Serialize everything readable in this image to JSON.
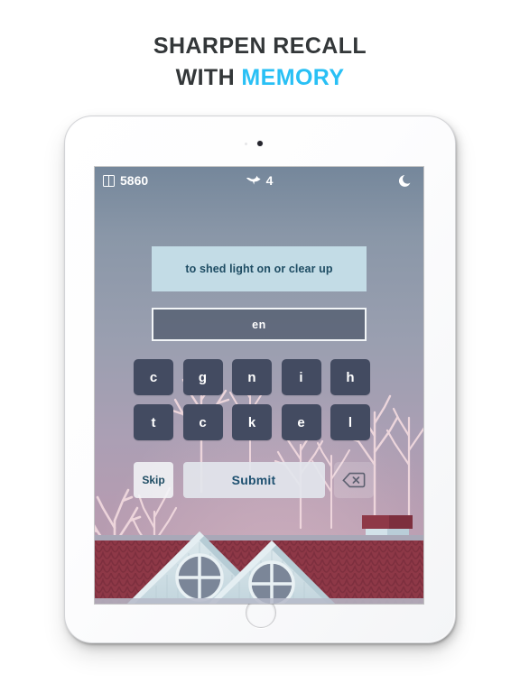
{
  "headline": {
    "line1": "SHARPEN RECALL",
    "line2_prefix": "WITH ",
    "line2_accent": "MEMORY",
    "accent_color": "#29c0f5",
    "text_color": "#333739"
  },
  "device": {
    "type": "tablet",
    "frame_color": "#fbfbfc",
    "camera": "camera-dot",
    "home_button": "home-button"
  },
  "status_bar": {
    "score_icon": "cards-icon",
    "score": "5860",
    "lives_icon": "bird-icon",
    "lives": "4",
    "mode_icon": "moon-icon"
  },
  "quiz": {
    "prompt": "to shed light on or clear up",
    "prompt_bg": "#c3dce6",
    "prompt_text_color": "#1e4c63",
    "answer_value": "en",
    "answer_placeholder": "",
    "letter_rows": [
      [
        "c",
        "g",
        "n",
        "i",
        "h"
      ],
      [
        "t",
        "c",
        "k",
        "e",
        "l"
      ]
    ],
    "key_color": "#434b61"
  },
  "actions": {
    "skip_label": "Skip",
    "submit_label": "Submit",
    "backspace_icon": "backspace-icon"
  },
  "scene": {
    "description": "winter rooftops at dusk",
    "roof_color": "#8e3847",
    "gable_color": "#cfe0e6",
    "tree_color": "#f0d8de",
    "sky_top": "#75879b",
    "sky_bottom": "#bb9cae"
  }
}
